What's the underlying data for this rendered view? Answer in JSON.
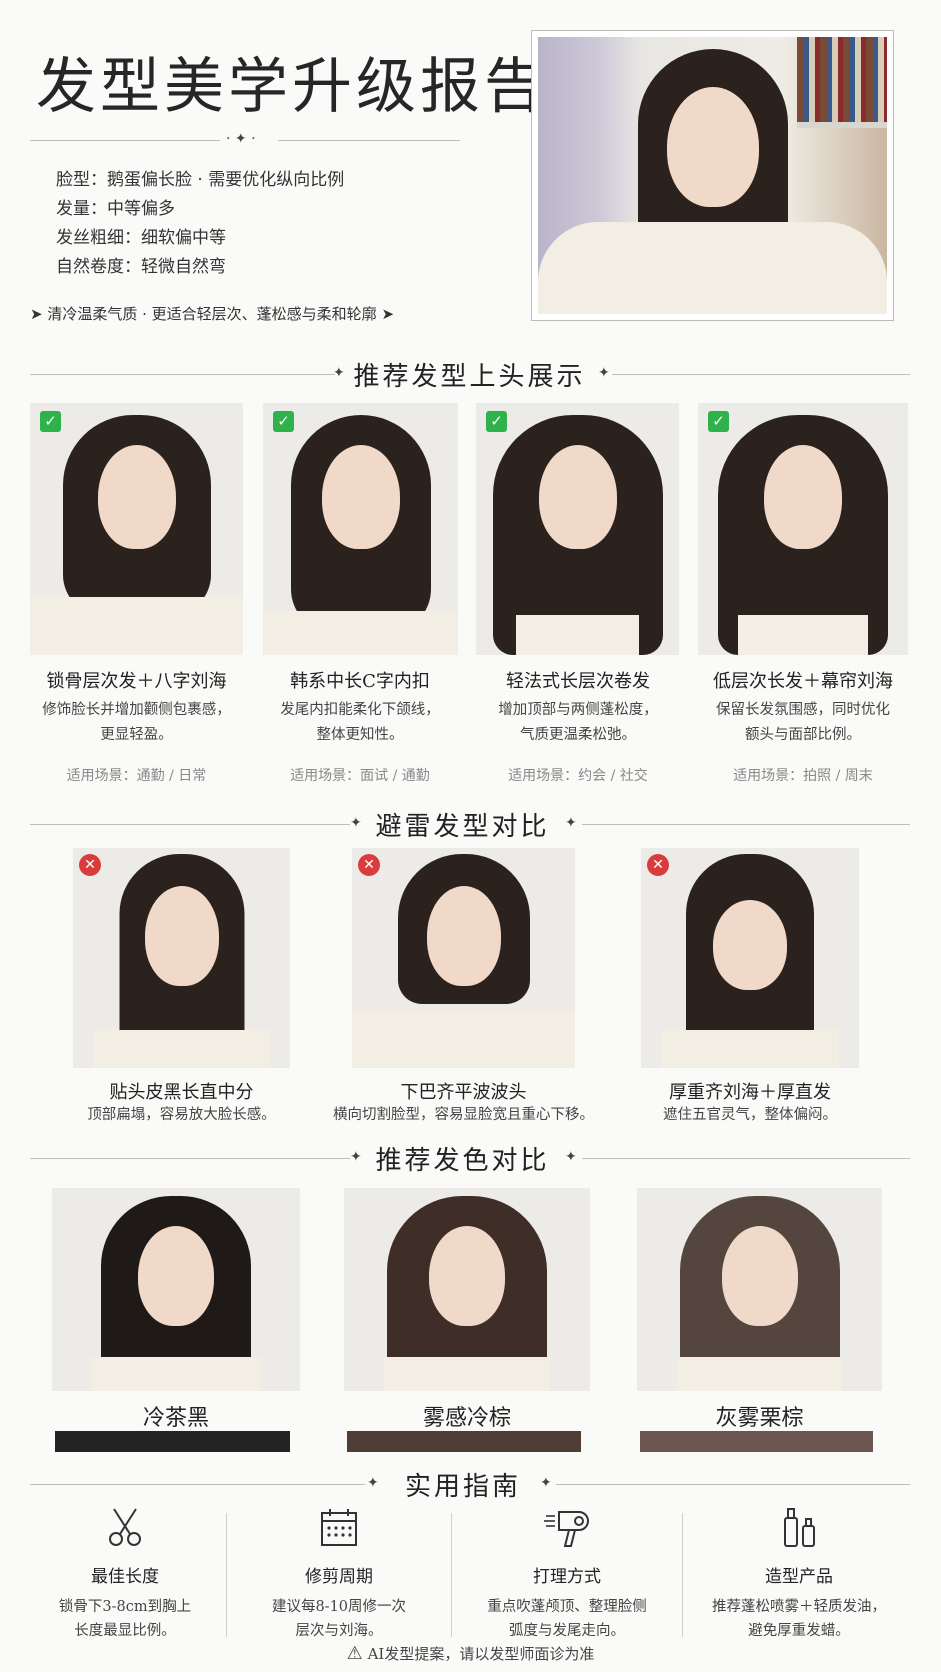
{
  "header": {
    "title": "发型美学升级报告",
    "profile": [
      "脸型：鹅蛋偏长脸 · 需要优化纵向比例",
      "发量：中等偏多",
      "发丝粗细：细软偏中等",
      "自然卷度：轻微自然弯"
    ],
    "tagline": "清冷温柔气质 · 更适合轻层次、蓬松感与柔和轮廓"
  },
  "recommended": {
    "heading": "推荐发型上头展示",
    "items": [
      {
        "title": "锁骨层次发＋八字刘海",
        "desc1": "修饰脸长并增加颧侧包裹感，",
        "desc2": "更显轻盈。",
        "scene": "适用场景：通勤 / 日常"
      },
      {
        "title": "韩系中长C字内扣",
        "desc1": "发尾内扣能柔化下颌线，",
        "desc2": "整体更知性。",
        "scene": "适用场景：面试 / 通勤"
      },
      {
        "title": "轻法式长层次卷发",
        "desc1": "增加顶部与两侧蓬松度，",
        "desc2": "气质更温柔松弛。",
        "scene": "适用场景：约会 / 社交"
      },
      {
        "title": "低层次长发＋幕帘刘海",
        "desc1": "保留长发氛围感，同时优化",
        "desc2": "额头与面部比例。",
        "scene": "适用场景：拍照 / 周末"
      }
    ]
  },
  "avoid": {
    "heading": "避雷发型对比",
    "items": [
      {
        "title": "贴头皮黑长直中分",
        "desc": "顶部扁塌，容易放大脸长感。"
      },
      {
        "title": "下巴齐平波波头",
        "desc": "横向切割脸型，容易显脸宽且重心下移。"
      },
      {
        "title": "厚重齐刘海＋厚直发",
        "desc": "遮住五官灵气，整体偏闷。"
      }
    ]
  },
  "colors": {
    "heading": "推荐发色对比",
    "items": [
      {
        "name": "冷茶黑",
        "swatch": "#232323",
        "hair": "#1f1a18"
      },
      {
        "name": "雾感冷棕",
        "swatch": "#4f3e36",
        "hair": "#3e2e27"
      },
      {
        "name": "灰雾栗棕",
        "swatch": "#6b5652",
        "hair": "#54463f"
      }
    ]
  },
  "guide": {
    "heading": "实用指南",
    "items": [
      {
        "icon": "scissors-icon",
        "title": "最佳长度",
        "desc1": "锁骨下3-8cm到胸上",
        "desc2": "长度最显比例。"
      },
      {
        "icon": "calendar-icon",
        "title": "修剪周期",
        "desc1": "建议每8-10周修一次",
        "desc2": "层次与刘海。"
      },
      {
        "icon": "hair-dryer-icon",
        "title": "打理方式",
        "desc1": "重点吹蓬颅顶、整理脸侧",
        "desc2": "弧度与发尾走向。"
      },
      {
        "icon": "bottles-icon",
        "title": "造型产品",
        "desc1": "推荐蓬松喷雾＋轻质发油，",
        "desc2": "避免厚重发蜡。"
      }
    ]
  },
  "footer": {
    "note": "AI发型提案，请以发型师面诊为准"
  }
}
